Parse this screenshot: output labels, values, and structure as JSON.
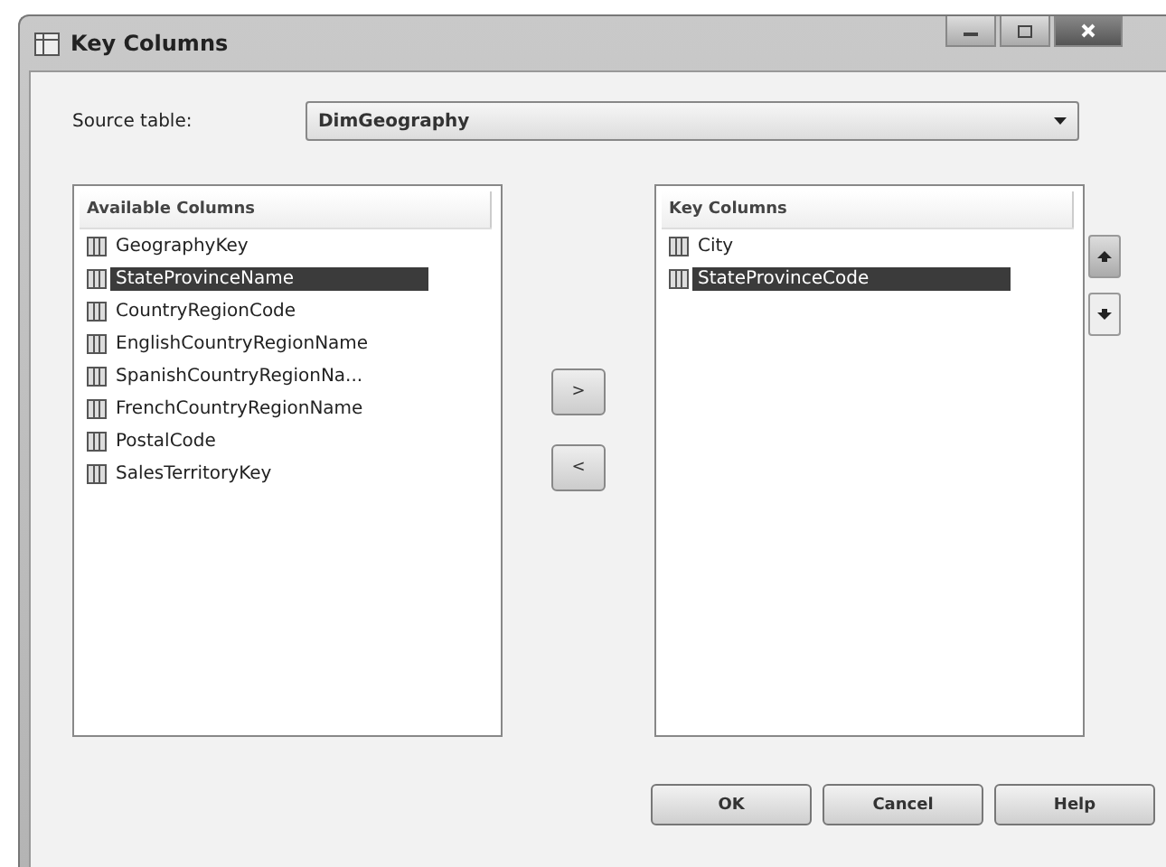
{
  "window": {
    "title": "Key Columns"
  },
  "source_table": {
    "label": "Source table:",
    "value": "DimGeography"
  },
  "available_columns": {
    "header": "Available Columns",
    "items": [
      {
        "label": "GeographyKey",
        "selected": false
      },
      {
        "label": "StateProvinceName",
        "selected": true
      },
      {
        "label": "CountryRegionCode",
        "selected": false
      },
      {
        "label": "EnglishCountryRegionName",
        "selected": false
      },
      {
        "label": "SpanishCountryRegionNa...",
        "selected": false
      },
      {
        "label": "FrenchCountryRegionName",
        "selected": false
      },
      {
        "label": "PostalCode",
        "selected": false
      },
      {
        "label": "SalesTerritoryKey",
        "selected": false
      }
    ]
  },
  "move_buttons": [
    ">",
    "<"
  ],
  "key_columns": {
    "header": "Key Columns",
    "items": [
      {
        "label": "City",
        "selected": false
      },
      {
        "label": "StateProvinceCode",
        "selected": true
      }
    ]
  },
  "buttons": [
    "OK",
    "Cancel",
    "Help"
  ]
}
